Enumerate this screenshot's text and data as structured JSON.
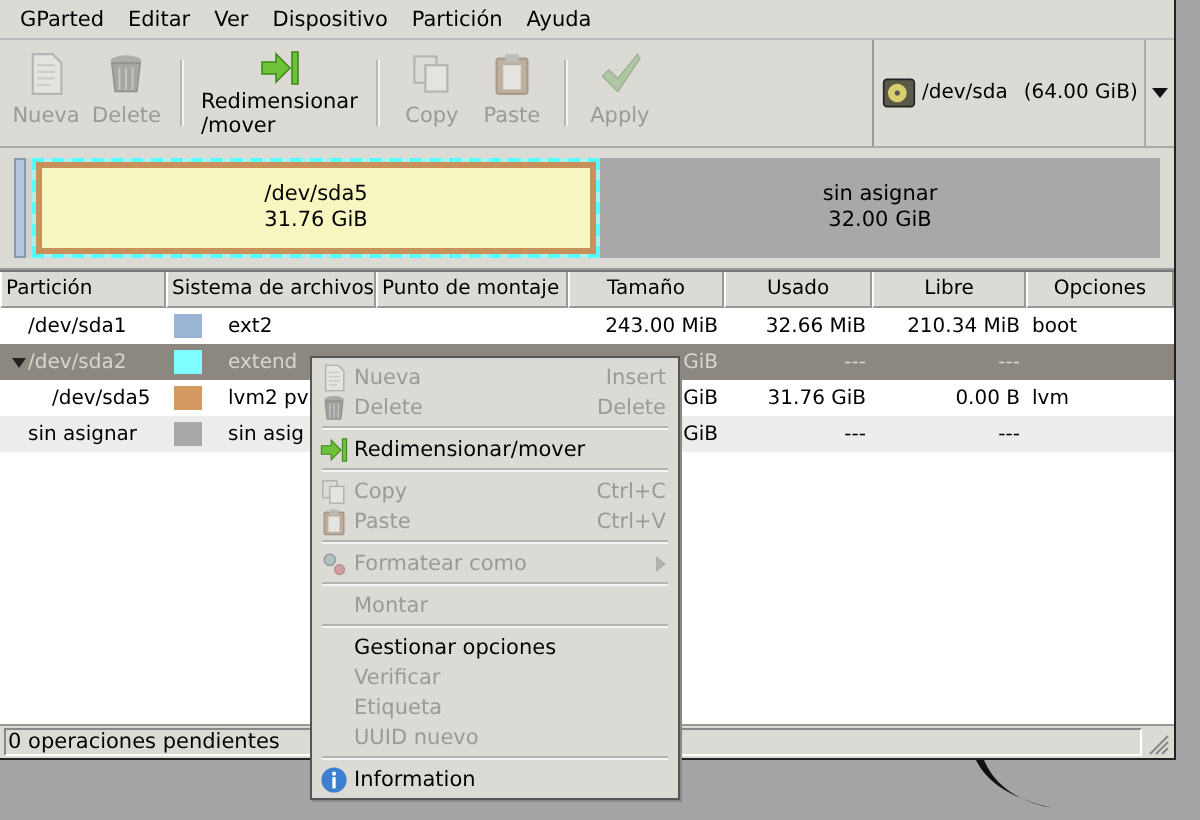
{
  "menubar": [
    "GParted",
    "Editar",
    "Ver",
    "Dispositivo",
    "Partición",
    "Ayuda"
  ],
  "toolbar": [
    [
      {
        "label": "Nueva",
        "disabled": true
      },
      {
        "label": "Delete",
        "disabled": true
      }
    ],
    [
      {
        "label": "Redimensionar\n/mover",
        "disabled": false
      }
    ],
    [
      {
        "label": "Copy",
        "disabled": true
      },
      {
        "label": "Paste",
        "disabled": true
      }
    ],
    [
      {
        "label": "Apply",
        "disabled": true
      }
    ]
  ],
  "device": {
    "path": "/dev/sda",
    "size": "(64.00 GiB)"
  },
  "map": {
    "segments": [
      {
        "label": "/dev/sda5",
        "size": "31.76 GiB",
        "kind": "partition",
        "color": "#c8905a",
        "selected": true
      },
      {
        "label": "sin asignar",
        "size": "32.00 GiB",
        "kind": "unallocated",
        "color": "#a8a8a8",
        "selected": false
      }
    ]
  },
  "table": {
    "columns": [
      "Partición",
      "Sistema de archivos",
      "Punto de montaje",
      "Tamaño",
      "Usado",
      "Libre",
      "Opciones"
    ],
    "rows": [
      {
        "partition": "/dev/sda1",
        "filesystem": "ext2",
        "color": "#9ab4d4",
        "size": "243.00 MiB",
        "used": "32.66 MiB",
        "free": "210.34 MiB",
        "flags": "boot",
        "selected": false
      },
      {
        "partition": "/dev/sda2",
        "filesystem": "extend",
        "color": "#7fffff",
        "size": "GiB",
        "used": "---",
        "free": "---",
        "selected": true,
        "expanded": true,
        "children": [
          {
            "partition": "/dev/sda5",
            "filesystem": "lvm2 pv",
            "color": "#d49a62",
            "size": "GiB",
            "used": "31.76 GiB",
            "free": "0.00 B",
            "flags": "lvm",
            "selected": false
          }
        ]
      },
      {
        "partition": "sin asignar",
        "filesystem": "sin asig",
        "color": "#a8a8a8",
        "size": "GiB",
        "used": "---",
        "free": "---",
        "selected": false
      }
    ]
  },
  "context_menu": [
    [
      {
        "label": "Nueva",
        "accel": "Insert",
        "disabled": true
      },
      {
        "label": "Delete",
        "accel": "Delete",
        "disabled": true
      }
    ],
    [
      {
        "label": "Redimensionar/mover",
        "disabled": false
      }
    ],
    [
      {
        "label": "Copy",
        "accel": "Ctrl+C",
        "disabled": true
      },
      {
        "label": "Paste",
        "accel": "Ctrl+V",
        "disabled": true
      }
    ],
    [
      {
        "label": "Formatear como",
        "disabled": true,
        "submenu": true
      }
    ],
    [
      {
        "label": "Montar",
        "disabled": true
      }
    ],
    [
      {
        "label": "Gestionar opciones",
        "disabled": false
      },
      {
        "label": "Verificar",
        "disabled": true
      },
      {
        "label": "Etiqueta",
        "disabled": true
      },
      {
        "label": "UUID nuevo",
        "disabled": true
      }
    ],
    [
      {
        "label": "Information",
        "disabled": false
      }
    ]
  ],
  "status_bar": "0 operaciones pendientes"
}
